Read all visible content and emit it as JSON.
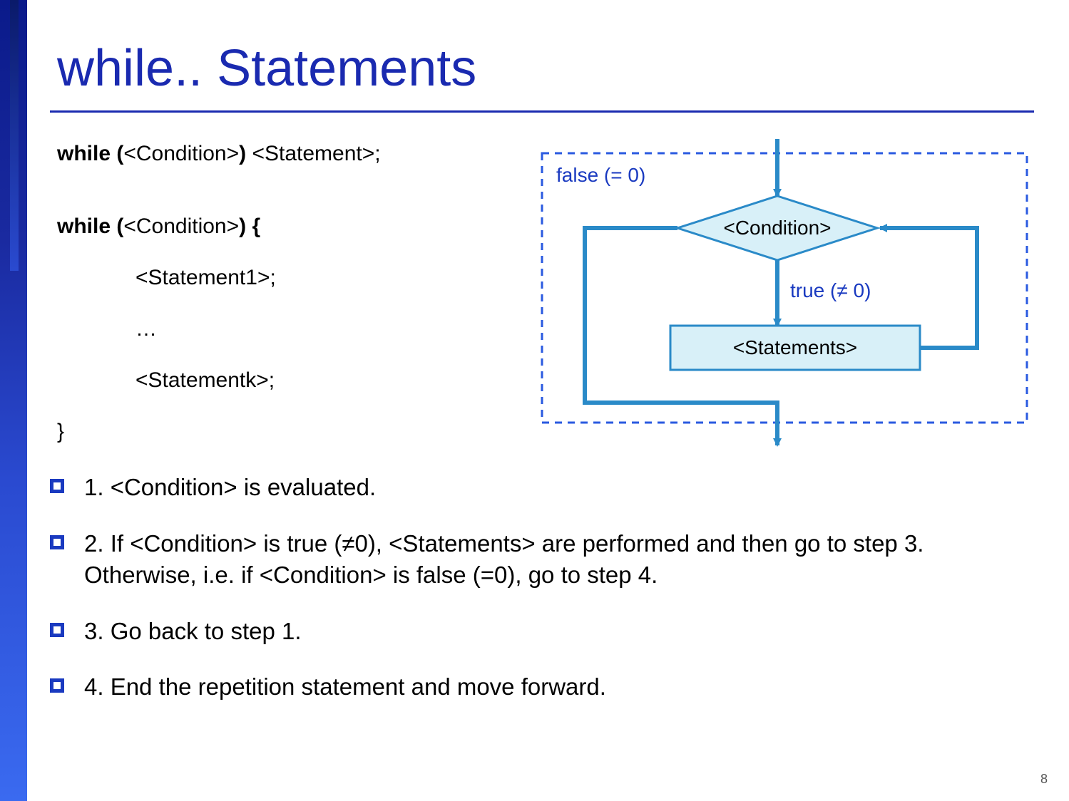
{
  "title": "while.. Statements",
  "code": {
    "l1_while": "while (",
    "l1_cond": "<Condition>",
    "l1_paren": ") ",
    "l1_stmt": "<Statement>;",
    "l2_while": "while (",
    "l2_cond": "<Condition>",
    "l2_brace": ") {",
    "l3": "<Statement1>;",
    "l4": "…",
    "l5": "<Statementk>;",
    "l6": "}"
  },
  "diagram": {
    "false_label": "false (= 0)",
    "condition_label": "<Condition>",
    "true_label": "true (≠ 0)",
    "statements_label": "<Statements>"
  },
  "bullets": {
    "b1": "1. <Condition> is evaluated.",
    "b2": "2. If <Condition> is true (≠0), <Statements> are performed and then go to step 3. Otherwise, i.e. if <Condition> is false (=0), go to step 4.",
    "b3": "3. Go back to step 1.",
    "b4": "4. End the repetition statement and move forward."
  },
  "page_number": "8"
}
